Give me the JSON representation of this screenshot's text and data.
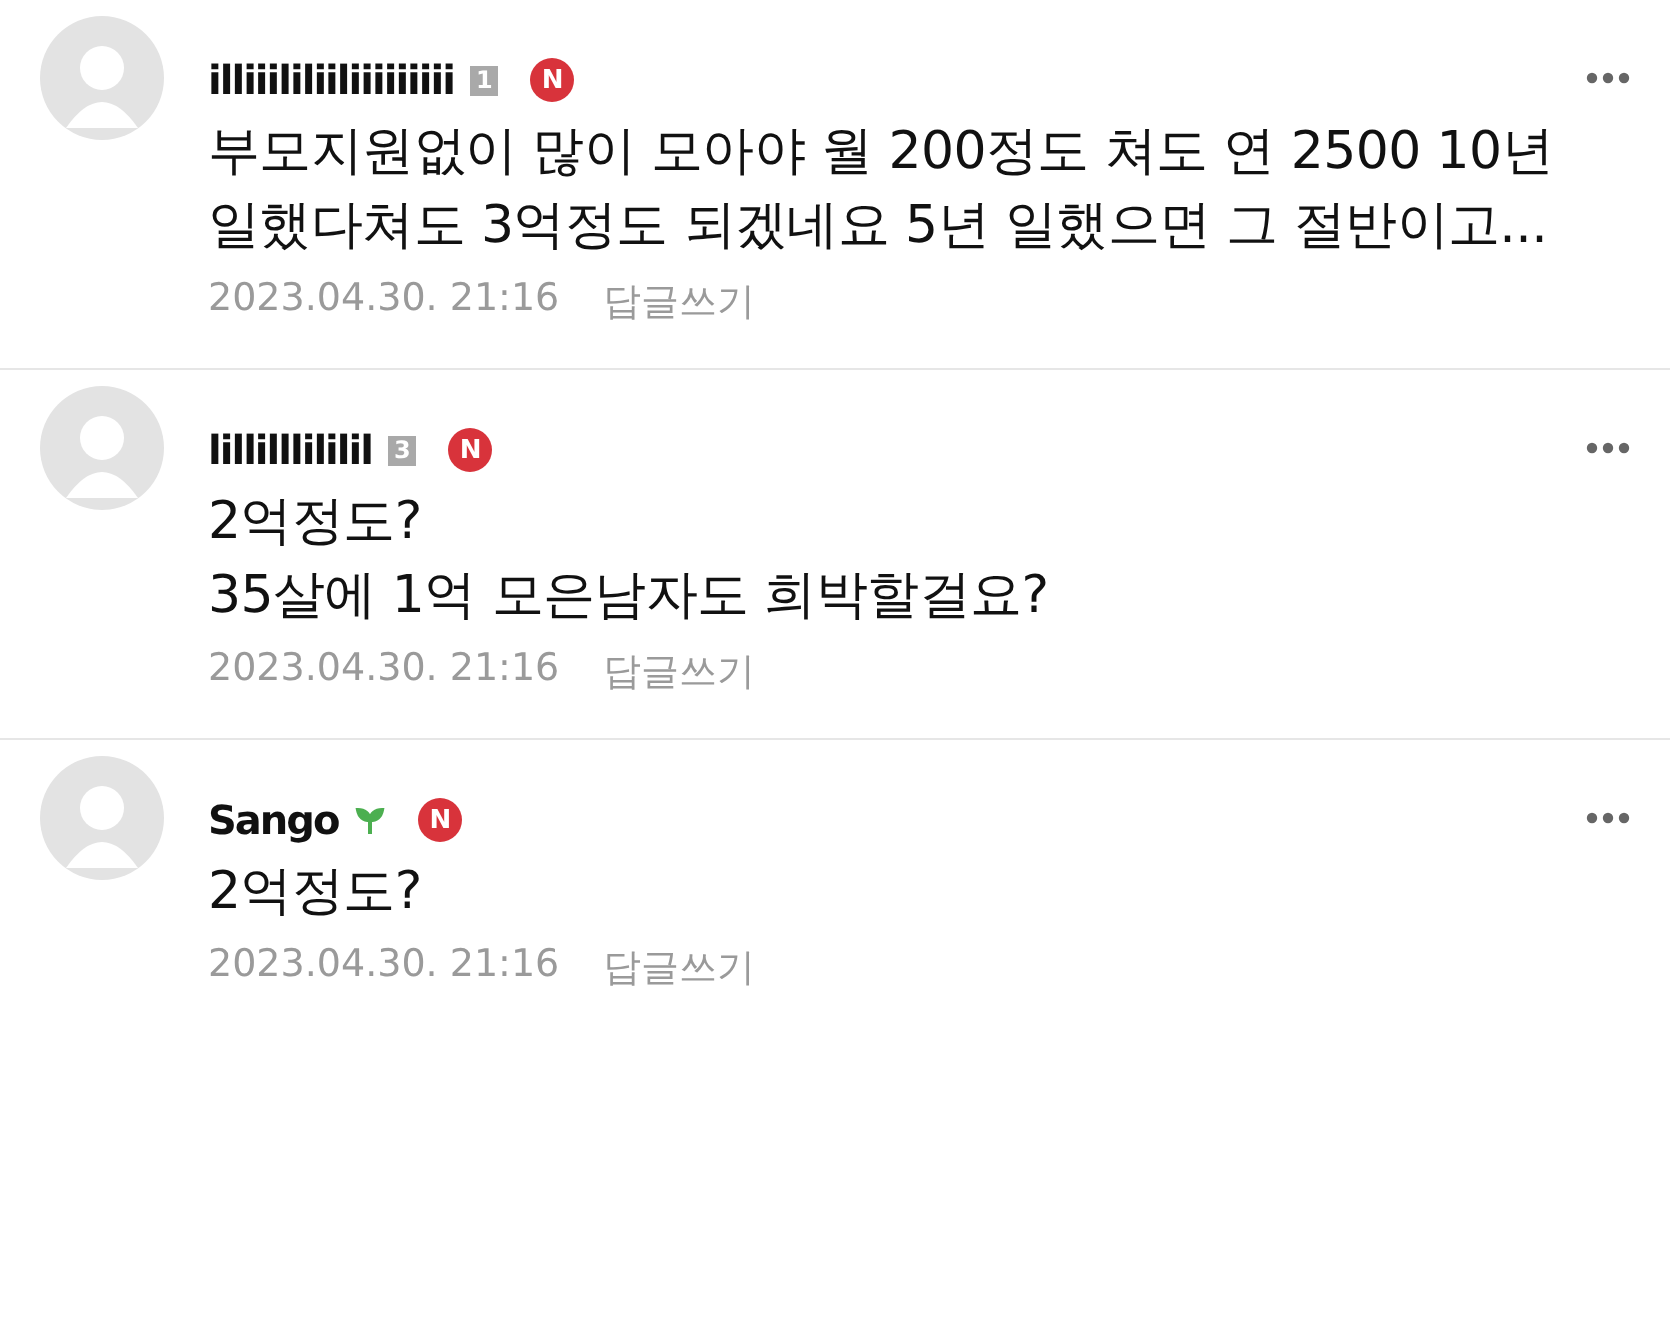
{
  "comments": [
    {
      "author": "illiiililiiliiiiiiiii",
      "badge": {
        "kind": "level",
        "text": "1"
      },
      "is_new": true,
      "new_label": "N",
      "body": "부모지원없이 많이 모아야 월 200정도 쳐도 연 2500 10년 일했다쳐도 3억정도 되겠네요 5년 일했으면 그 절반이고...",
      "date": "2023.04.30. 21:16",
      "reply": "답글쓰기"
    },
    {
      "author": "lillilllililil",
      "badge": {
        "kind": "level",
        "text": "3"
      },
      "is_new": true,
      "new_label": "N",
      "body": "2억정도?\n35살에 1억 모은남자도 희박할걸요?",
      "date": "2023.04.30. 21:16",
      "reply": "답글쓰기"
    },
    {
      "author": "Sango",
      "badge": {
        "kind": "sprout"
      },
      "is_new": true,
      "new_label": "N",
      "body": "2억정도?",
      "date": "2023.04.30. 21:16",
      "reply": "답글쓰기"
    }
  ]
}
